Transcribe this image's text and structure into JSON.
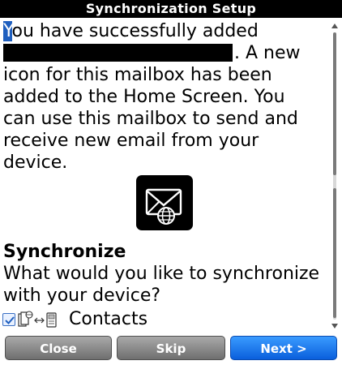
{
  "window": {
    "title": "Synchronization Setup"
  },
  "message": {
    "first_char": "Y",
    "line1_rest": "ou have successfully added",
    "line2_tail": ". A new",
    "line3": "icon for this mailbox has been",
    "line4": "added to the Home Screen. You",
    "line5": "can use this mailbox to send and",
    "line6": "receive new email from your",
    "line7": "device."
  },
  "app_icon": {
    "icon": "mailbox-envelope-globe-icon"
  },
  "sync": {
    "heading": "Synchronize",
    "question_line1": "What would you like to synchronize",
    "question_line2": "with your device?",
    "options": [
      {
        "label": "Contacts",
        "checked": true,
        "icon": "device-sync-handheld-icon"
      }
    ]
  },
  "buttons": {
    "close": "Close",
    "skip": "Skip",
    "next": "Next >"
  },
  "colors": {
    "titlebar": "#000000",
    "accent_blue": "#0a5fdc",
    "button_gray": "#8a8a8a"
  }
}
